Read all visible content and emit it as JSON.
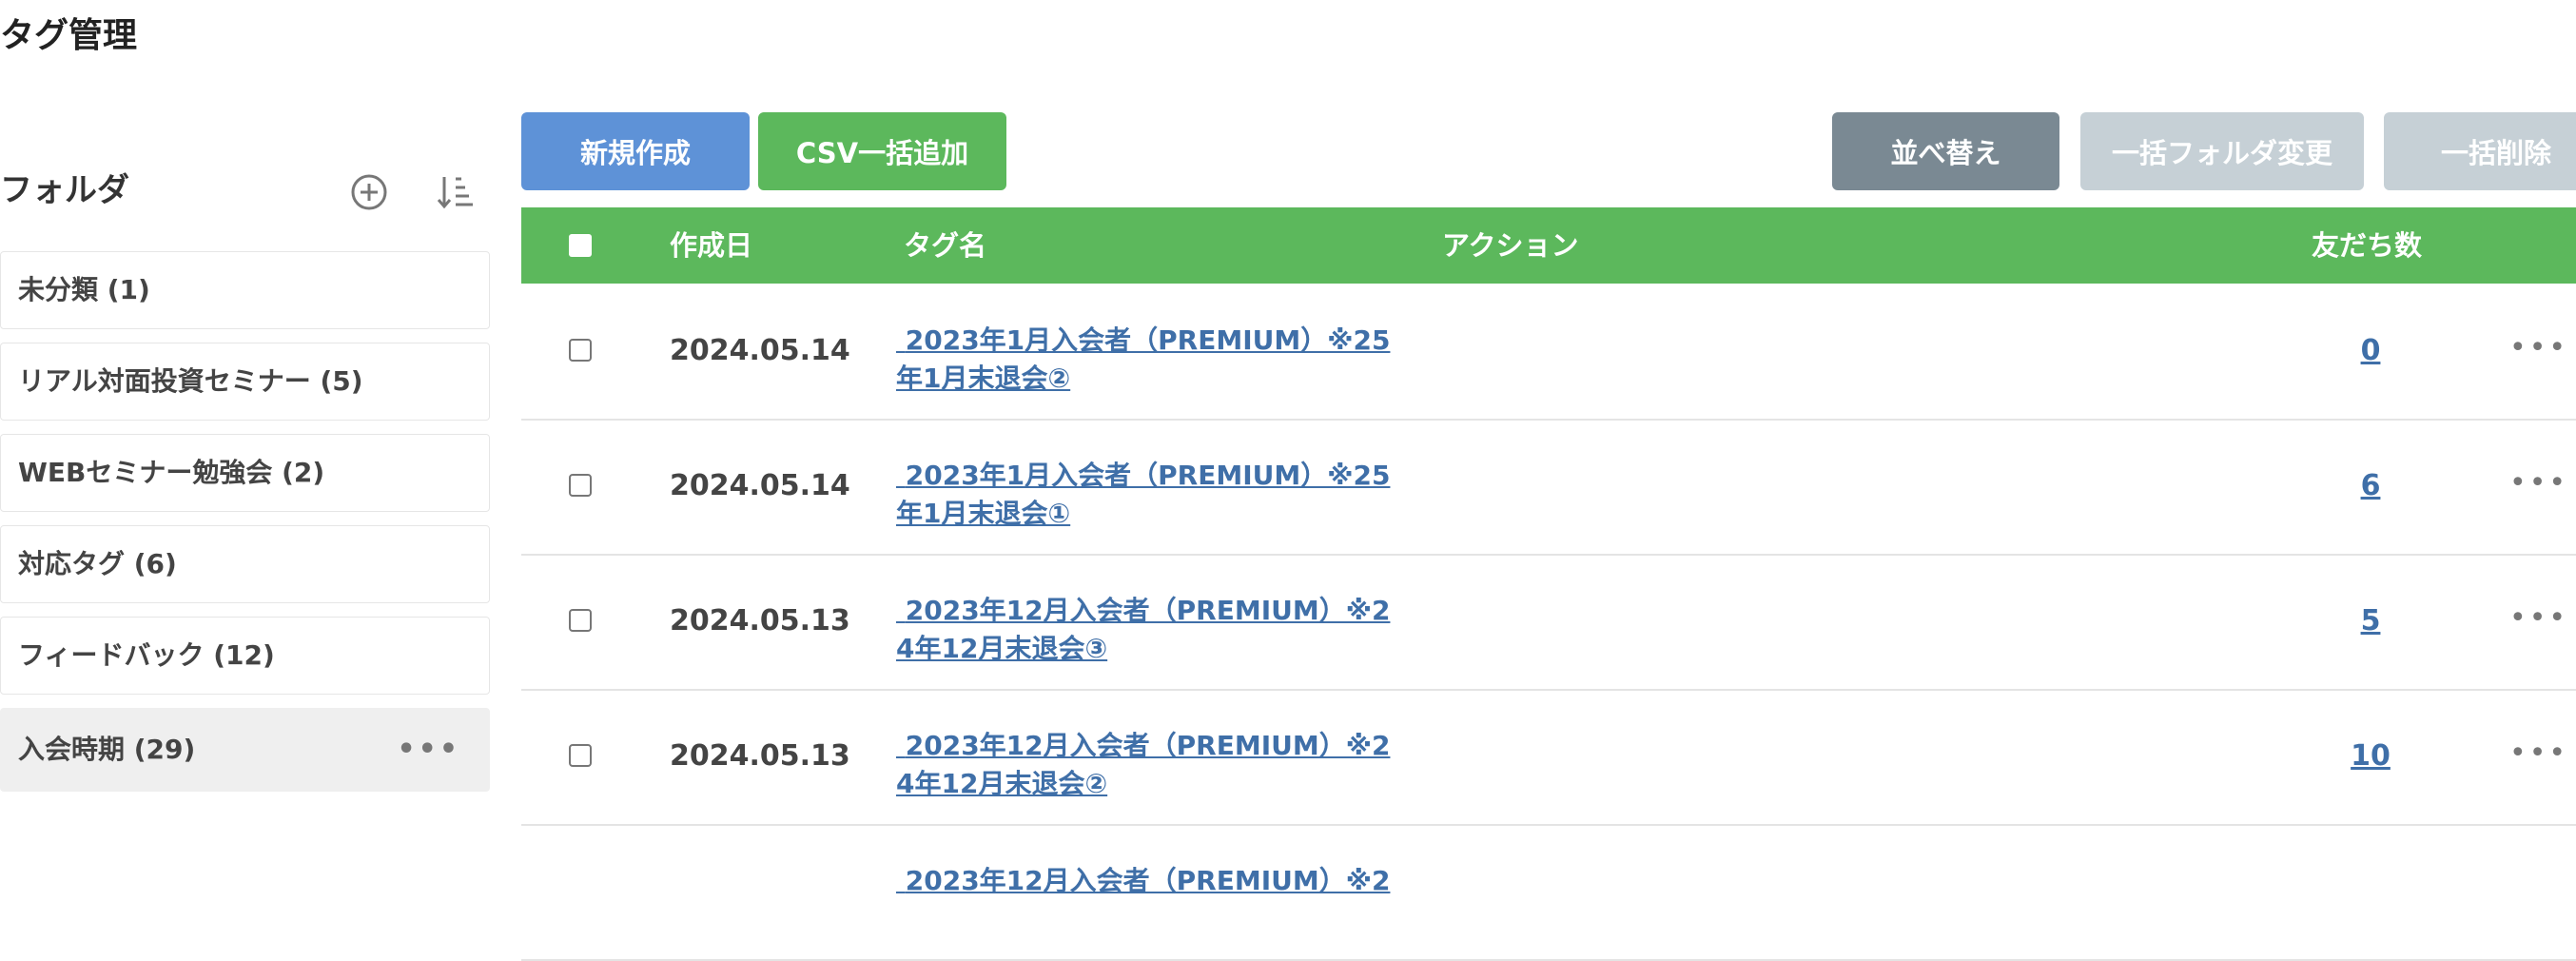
{
  "page": {
    "title": "タグ管理"
  },
  "sidebar": {
    "title": "フォルダ",
    "add_icon": "plus-circle-icon",
    "sort_icon": "sort-icon",
    "items": [
      {
        "label": "未分類 (1)",
        "active": false
      },
      {
        "label": "リアル対面投資セミナー (5)",
        "active": false
      },
      {
        "label": "WEBセミナー勉強会 (2)",
        "active": false
      },
      {
        "label": "対応タグ (6)",
        "active": false
      },
      {
        "label": "フィードバック (12)",
        "active": false
      },
      {
        "label": "入会時期 (29)",
        "active": true,
        "more": "•••"
      }
    ]
  },
  "toolbar": {
    "new_label": "新規作成",
    "csv_label": "CSV一括追加",
    "sort_label": "並べ替え",
    "bulk_folder_label": "一括フォルダ変更",
    "bulk_delete_label": "一括削除"
  },
  "table": {
    "headers": {
      "date": "作成日",
      "tag_name": "タグ名",
      "action": "アクション",
      "friends": "友だち数"
    },
    "rows": [
      {
        "date": "2024.05.14",
        "name": " 2023年1月入会者（PREMIUM）※25\n年1月末退会②",
        "count": "0",
        "more": "•••"
      },
      {
        "date": "2024.05.14",
        "name": " 2023年1月入会者（PREMIUM）※25\n年1月末退会①",
        "count": "6",
        "more": "•••"
      },
      {
        "date": "2024.05.13",
        "name": " 2023年12月入会者（PREMIUM）※2\n4年12月末退会③",
        "count": "5",
        "more": "•••"
      },
      {
        "date": "2024.05.13",
        "name": " 2023年12月入会者（PREMIUM）※2\n4年12月末退会②",
        "count": "10",
        "more": "•••"
      },
      {
        "date": "",
        "name": " 2023年12月入会者（PREMIUM）※2",
        "count": "",
        "more": ""
      }
    ]
  },
  "colors": {
    "primary": "#5e92d7",
    "success": "#5cb85c",
    "sort": "#7a8993",
    "disabled": "#c6d0d6",
    "link": "#3f6fa8"
  }
}
